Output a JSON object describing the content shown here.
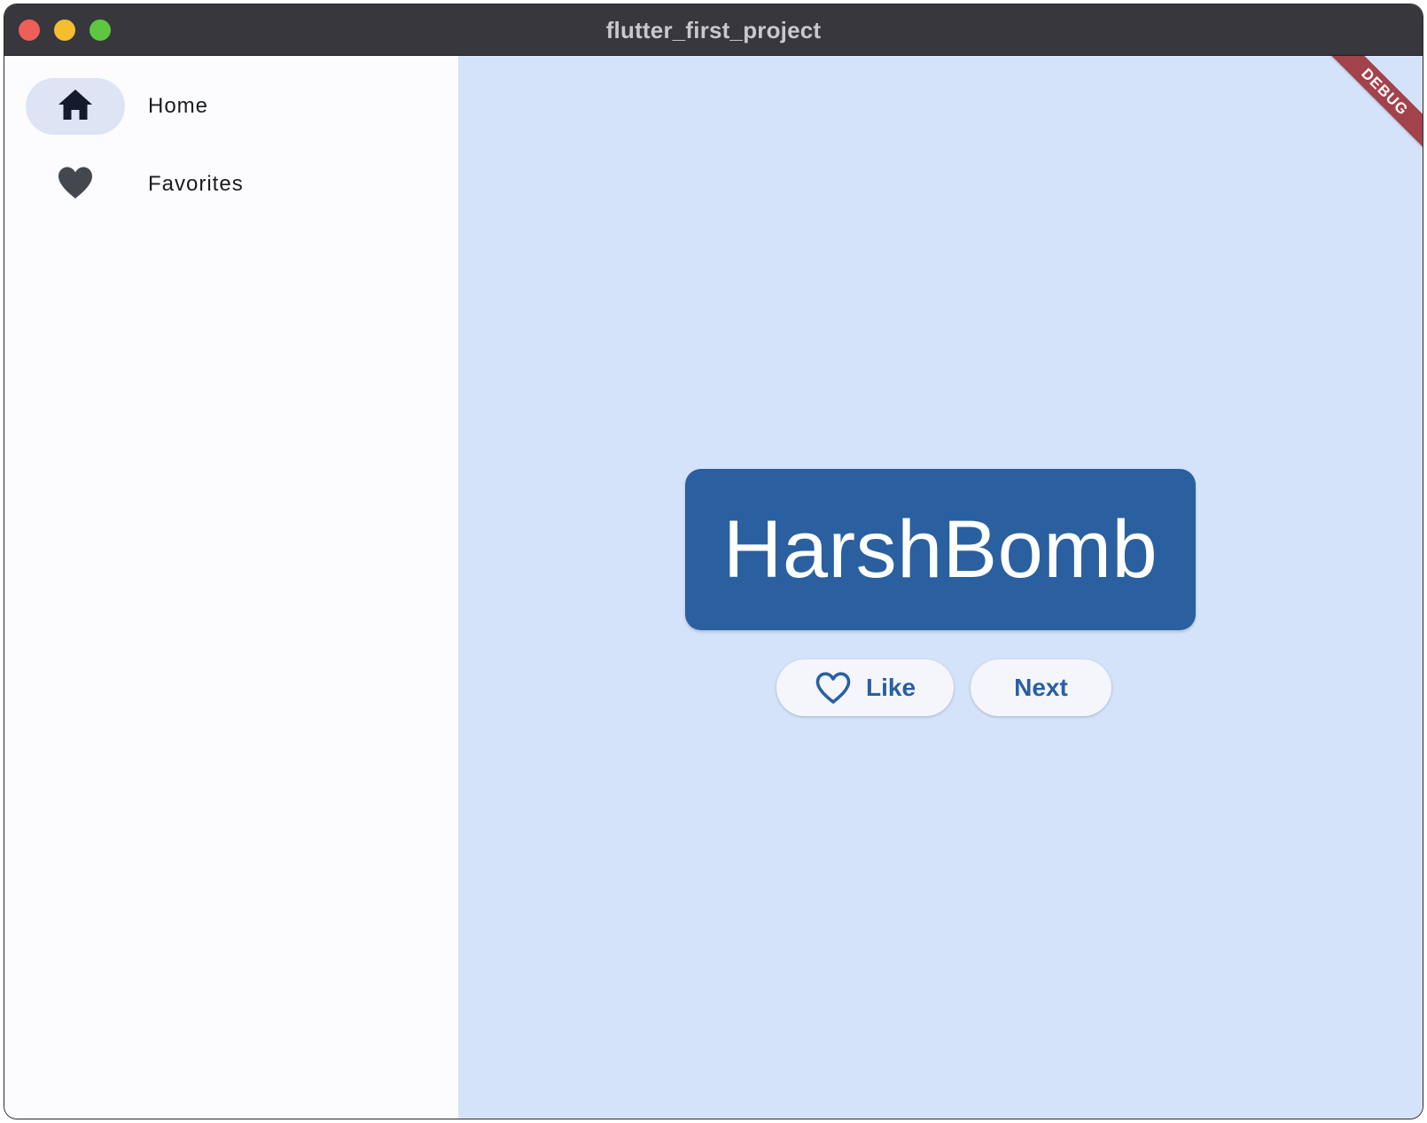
{
  "window": {
    "title": "flutter_first_project"
  },
  "navigation": {
    "items": [
      {
        "label": "Home",
        "icon": "home-icon",
        "selected": true
      },
      {
        "label": "Favorites",
        "icon": "heart-icon",
        "selected": false
      }
    ]
  },
  "debug_banner": "DEBUG",
  "main": {
    "word": "HarshBomb",
    "like_label": "Like",
    "next_label": "Next"
  },
  "colors": {
    "primary": "#2a60a0",
    "content_background": "#d5e3fa",
    "rail_background": "#fcfcff",
    "selected_indicator": "#dde4f4",
    "titlebar": "#37373d",
    "debug_banner": "#a2424b"
  }
}
